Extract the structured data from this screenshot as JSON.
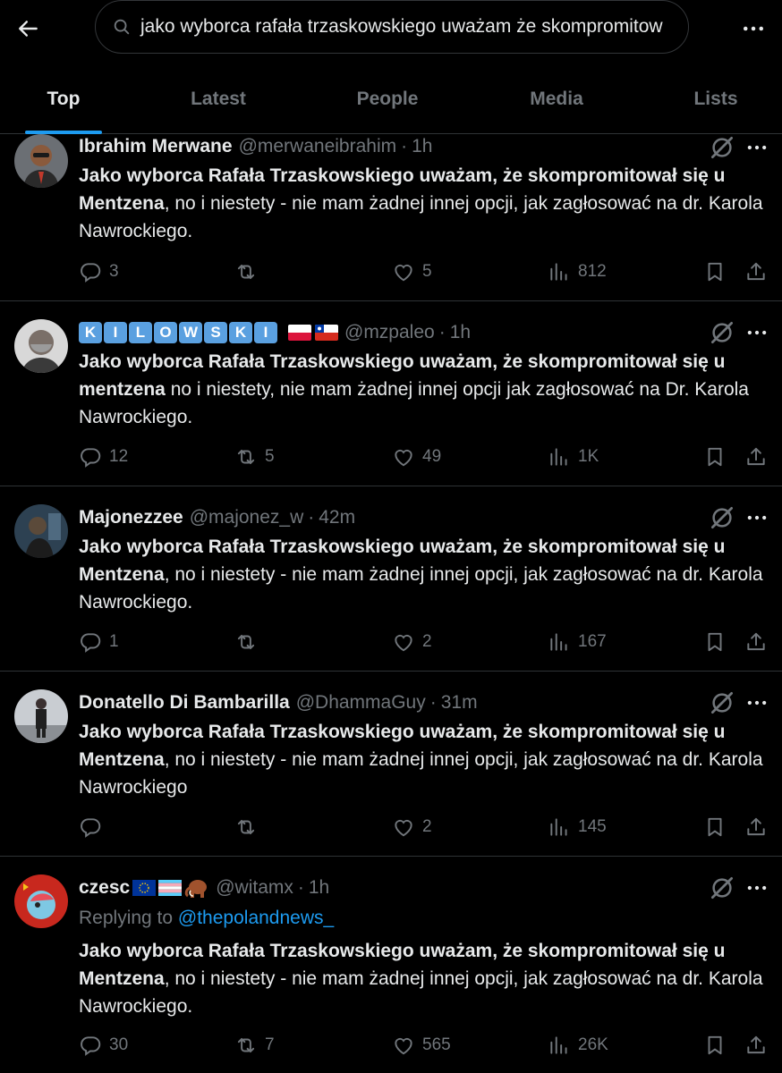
{
  "search": {
    "query": "jako wyborca rafała trzaskowskiego uważam że skompromitow"
  },
  "tabs": [
    {
      "label": "Top"
    },
    {
      "label": "Latest"
    },
    {
      "label": "People"
    },
    {
      "label": "Media"
    },
    {
      "label": "Lists"
    }
  ],
  "colors": {
    "accent": "#1d9bf0",
    "background": "#000000",
    "muted": "#71767b",
    "text": "#e7e9ea",
    "divider": "#2f3336"
  },
  "tweets": [
    {
      "display_name": "Ibrahim Merwane",
      "handle": "@merwaneibrahim",
      "dot": "·",
      "time": "1h",
      "bold_text": "Jako wyborca Rafała Trzaskowskiego uważam, że skompromitował się u Mentzena",
      "rest_text": ", no i niestety - nie mam żadnej innej opcji, jak zagłosować na dr. Karola Nawrockiego.",
      "replies": "3",
      "reposts": "",
      "likes": "5",
      "views": "812"
    },
    {
      "display_name_letters": [
        "K",
        "I",
        "L",
        "O",
        "W",
        "S",
        "K",
        "I"
      ],
      "display_name_flags": [
        "flag-poland",
        "flag-chile"
      ],
      "handle": "@mzpaleo",
      "dot": "·",
      "time": "1h",
      "bold_text": "Jako wyborca Rafała Trzaskowskiego uważam, że skompromitował się u mentzena",
      "rest_text": " no i niestety, nie mam żadnej innej opcji jak zagłosować na Dr. Karola Nawrockiego.",
      "replies": "12",
      "reposts": "5",
      "likes": "49",
      "views": "1K"
    },
    {
      "display_name": "Majonezzee",
      "handle": "@majonez_w",
      "dot": "·",
      "time": "42m",
      "bold_text": "Jako wyborca Rafała Trzaskowskiego uważam, że skompromitował się u Mentzena",
      "rest_text": ", no i niestety - nie mam żadnej innej opcji, jak zagłosować na dr. Karola Nawrockiego.",
      "replies": "1",
      "reposts": "",
      "likes": "2",
      "views": "167"
    },
    {
      "display_name": "Donatello Di Bambarilla",
      "handle": "@DhammaGuy",
      "dot": "·",
      "time": "31m",
      "bold_text": "Jako wyborca Rafała Trzaskowskiego uważam, że skompromitował się u Mentzena",
      "rest_text": ", no i niestety - nie mam żadnej innej opcji, jak zagłosować na dr. Karola Nawrockiego",
      "replies": "",
      "reposts": "",
      "likes": "2",
      "views": "145"
    },
    {
      "display_name": "czesc",
      "display_name_emojis": [
        "flag-eu",
        "flag-transgender",
        "mammoth"
      ],
      "handle": "@witamx",
      "dot": "·",
      "time": "1h",
      "replying_prefix": "Replying to ",
      "replying_to": "@thepolandnews_",
      "bold_text": "Jako wyborca Rafała Trzaskowskiego uważam, że skompromitował się u Mentzena",
      "rest_text": ", no i niestety - nie mam żadnej innej opcji, jak zagłosować na dr. Karola Nawrockiego.",
      "replies": "30",
      "reposts": "7",
      "likes": "565",
      "views": "26K"
    }
  ]
}
